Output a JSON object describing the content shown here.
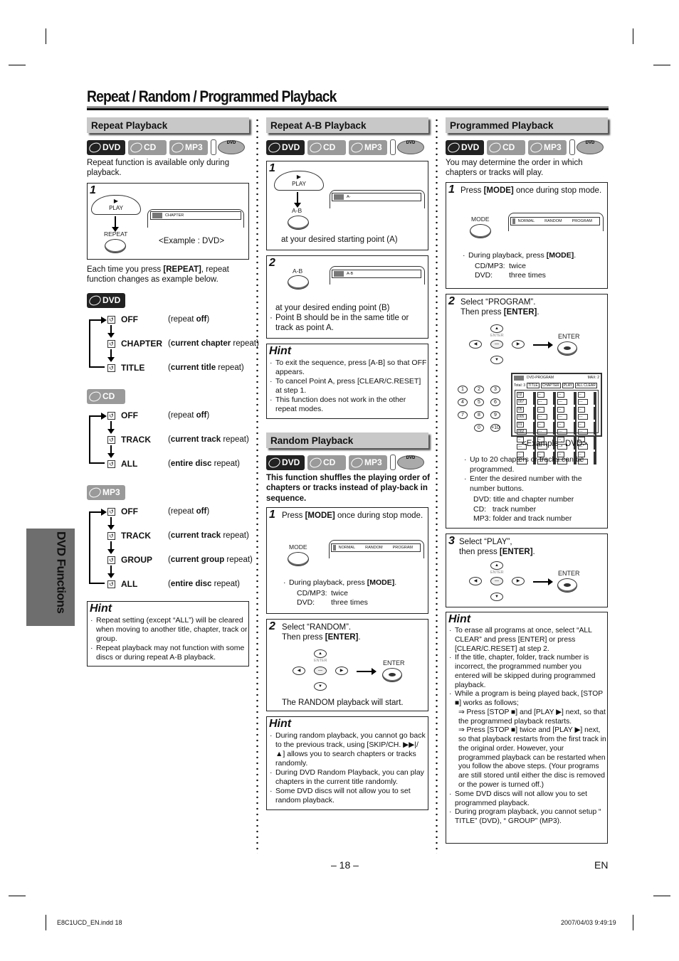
{
  "page": {
    "title": "Repeat / Random / Programmed Playback",
    "side_tab": "DVD Functions",
    "page_number": "– 18 –",
    "language": "EN",
    "footer_file": "E8C1UCD_EN.indd   18",
    "footer_timestamp": "2007/04/03   9:49:19"
  },
  "badges": {
    "dvd": "DVD",
    "cd": "CD",
    "mp3": "MP3",
    "tray": "DVD"
  },
  "repeat": {
    "heading": "Repeat Playback",
    "intro": "Repeat function is available only during playback.",
    "step1": {
      "num": "1",
      "play_label": "PLAY",
      "repeat_label": "REPEAT",
      "screen_text": "CHAPTER",
      "example": "<Example : DVD>"
    },
    "each_time_pre": "Each time you press ",
    "each_time_key": "[REPEAT]",
    "each_time_post": ", repeat function changes as example below.",
    "dvd_flow": [
      {
        "name": "OFF",
        "pre": "(repeat ",
        "bold": "off",
        "post": ")"
      },
      {
        "name": "CHAPTER",
        "pre": "(",
        "bold": "current chapter",
        "post": " repeat)"
      },
      {
        "name": "TITLE",
        "pre": "(",
        "bold": "current title",
        "post": " repeat)"
      }
    ],
    "cd_flow": [
      {
        "name": "OFF",
        "pre": "(repeat ",
        "bold": "off",
        "post": ")"
      },
      {
        "name": "TRACK",
        "pre": "(",
        "bold": "current track",
        "post": " repeat)"
      },
      {
        "name": "ALL",
        "pre": "(",
        "bold": "entire disc",
        "post": " repeat)"
      }
    ],
    "mp3_flow": [
      {
        "name": "OFF",
        "pre": "(repeat ",
        "bold": "off",
        "post": ")"
      },
      {
        "name": "TRACK",
        "pre": "(",
        "bold": "current track",
        "post": " repeat)"
      },
      {
        "name": "GROUP",
        "pre": "(",
        "bold": "current group",
        "post": " repeat)"
      },
      {
        "name": "ALL",
        "pre": "(",
        "bold": "entire disc",
        "post": " repeat)"
      }
    ],
    "hint_title": "Hint",
    "hints": [
      "Repeat setting (except “ALL”) will be cleared when moving to another title, chapter, track or group.",
      "Repeat playback may not function with some discs or during repeat A-B playback."
    ]
  },
  "ab": {
    "heading": "Repeat A-B Playback",
    "step1": {
      "num": "1",
      "play_label": "PLAY",
      "ab_label": "A-B",
      "screen_text": "A-",
      "caption": "at your desired starting point (A)"
    },
    "step2": {
      "num": "2",
      "ab_label": "A-B",
      "screen_text": "A-B",
      "caption": "at your desired ending point (B)",
      "note": "Point B should be in the same title or track as point A."
    },
    "hint_title": "Hint",
    "hints": [
      "To exit the sequence, press [A-B] so that OFF appears.",
      "To cancel Point A, press [CLEAR/C.RESET] at step 1.",
      "This function does not work in the other repeat modes."
    ]
  },
  "random": {
    "heading": "Random Playback",
    "intro": "This function shuffles the playing order of chapters or tracks instead of play-back in sequence.",
    "step1": {
      "num": "1",
      "text_pre": "Press ",
      "text_key": "[MODE]",
      "text_post": " once during stop mode.",
      "mode_label": "MODE",
      "screen_items": [
        "NORMAL",
        "RANDOM",
        "PROGRAM"
      ],
      "note_pre": "During playback, press ",
      "note_key": "[MODE]",
      "note_post": ".",
      "counts": [
        {
          "k": "CD/MP3:",
          "v": "twice"
        },
        {
          "k": "DVD:",
          "v": "three times"
        }
      ]
    },
    "step2": {
      "num": "2",
      "line1": "Select “RANDOM”.",
      "line2_pre": "Then press ",
      "line2_key": "[ENTER]",
      "line2_post": ".",
      "enter_small": "ENTER",
      "enter_label": "ENTER",
      "caption": "The RANDOM playback will start."
    },
    "hint_title": "Hint",
    "hints": [
      "During random playback, you cannot go back to the previous track, using [SKIP/CH. ▶▶|/▲] allows you to search chapters or tracks randomly.",
      "During DVD Random Playback, you can play chapters in the current title randomly.",
      "Some DVD discs will not allow you to set random playback."
    ]
  },
  "program": {
    "heading": "Programmed Playback",
    "intro": "You may determine the order in which chapters or tracks will play.",
    "step1": {
      "num": "1",
      "text_pre": "Press ",
      "text_key": "[MODE]",
      "text_post": " once during stop mode.",
      "mode_label": "MODE",
      "screen_items": [
        "NORMAL",
        "RANDOM",
        "PROGRAM"
      ],
      "note_pre": "During playback, press ",
      "note_key": "[MODE]",
      "note_post": ".",
      "counts": [
        {
          "k": "CD/MP3:",
          "v": "twice"
        },
        {
          "k": "DVD:",
          "v": "three times"
        }
      ]
    },
    "step2": {
      "num": "2",
      "line1": "Select “PROGRAM”.",
      "line2_pre": "Then press ",
      "line2_key": "[ENTER]",
      "line2_post": ".",
      "enter_small": "ENTER",
      "enter_label": "ENTER",
      "number_keys": [
        "1",
        "2",
        "3",
        "4",
        "5",
        "6",
        "7",
        "8",
        "9",
        "",
        "0",
        "+10"
      ],
      "screen": {
        "title": "DVD-PROGRAM",
        "max": "MAX:   2",
        "total": "Total:  3",
        "buttons": [
          "TITLE",
          "CHAPTER",
          "PLAY",
          "ALL CLEAR"
        ],
        "entries": [
          [
            "02",
            "007"
          ],
          [
            "05",
            "005"
          ],
          [
            "01",
            "002"
          ],
          [
            "--",
            "---"
          ],
          [
            "--",
            "---"
          ]
        ]
      },
      "example": "<Example : DVD>",
      "notes": [
        "Up to 20 chapters or tracks can be programmed.",
        "Enter the desired number with the number buttons."
      ],
      "types": [
        "DVD: title and chapter number",
        "CD:   track number",
        "MP3: folder and track number"
      ]
    },
    "step3": {
      "num": "3",
      "line1": "Select “PLAY”,",
      "line2_pre": "then press ",
      "line2_key": "[ENTER]",
      "line2_post": ".",
      "enter_small": "ENTER",
      "enter_label": "ENTER"
    },
    "hint_title": "Hint",
    "hints": [
      "To erase all programs at once, select “ALL CLEAR” and press [ENTER] or press [CLEAR/C.RESET] at step 2.",
      "If the title, chapter, folder, track number is incorrect, the programmed number you entered will be skipped during programmed playback.",
      "While a program is being played back, [STOP ■] works as follows;",
      "⇒ Press [STOP ■] and [PLAY ▶] next, so that the programmed playback restarts.",
      "⇒ Press [STOP ■] twice and [PLAY ▶] next, so that playback restarts from the first track in the original order. However, your programmed playback can be restarted when you follow the above steps. (Your programs are still stored until either the disc is removed or the power is turned off.)",
      "Some DVD discs will not allow you to set programmed playback.",
      "During program playback, you cannot setup “ TITLE” (DVD), “ GROUP” (MP3)."
    ]
  }
}
